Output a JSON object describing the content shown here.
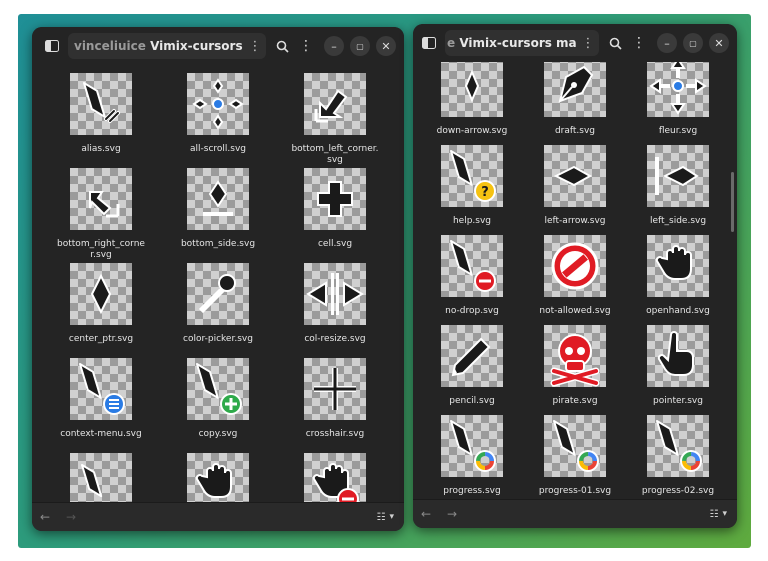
{
  "left_window": {
    "path_dim": "vinceliuice",
    "path_main": "Vimix-cursors master src-svg",
    "files": [
      {
        "label": "alias.svg",
        "icon": "alias-cursor-icon"
      },
      {
        "label": "all-scroll.svg",
        "icon": "all-scroll-cursor-icon"
      },
      {
        "label": "bottom_left_corner.\nsvg",
        "icon": "bottom-left-corner-cursor-icon"
      },
      {
        "label": "bottom_right_corne\nr.svg",
        "icon": "bottom-right-corner-cursor-icon"
      },
      {
        "label": "bottom_side.svg",
        "icon": "bottom-side-cursor-icon"
      },
      {
        "label": "cell.svg",
        "icon": "cell-cursor-icon"
      },
      {
        "label": "center_ptr.svg",
        "icon": "center-ptr-cursor-icon"
      },
      {
        "label": "color-picker.svg",
        "icon": "color-picker-cursor-icon"
      },
      {
        "label": "col-resize.svg",
        "icon": "col-resize-cursor-icon"
      },
      {
        "label": "context-menu.svg",
        "icon": "context-menu-cursor-icon"
      },
      {
        "label": "copy.svg",
        "icon": "copy-cursor-icon"
      },
      {
        "label": "crosshair.svg",
        "icon": "crosshair-cursor-icon"
      },
      {
        "label": "",
        "icon": "default-cursor-icon"
      },
      {
        "label": "",
        "icon": "dnd-cursor-icon"
      },
      {
        "label": "",
        "icon": "dnd-no-drop-cursor-icon"
      }
    ]
  },
  "right_window": {
    "path_dim": "e",
    "path_main": "Vimix-cursors master src-svg",
    "files": [
      {
        "label": "down-arrow.svg",
        "icon": "down-arrow-cursor-icon"
      },
      {
        "label": "draft.svg",
        "icon": "draft-cursor-icon"
      },
      {
        "label": "fleur.svg",
        "icon": "fleur-cursor-icon"
      },
      {
        "label": "help.svg",
        "icon": "help-cursor-icon"
      },
      {
        "label": "left-arrow.svg",
        "icon": "left-arrow-cursor-icon"
      },
      {
        "label": "left_side.svg",
        "icon": "left-side-cursor-icon"
      },
      {
        "label": "no-drop.svg",
        "icon": "no-drop-cursor-icon"
      },
      {
        "label": "not-allowed.svg",
        "icon": "not-allowed-cursor-icon"
      },
      {
        "label": "openhand.svg",
        "icon": "openhand-cursor-icon"
      },
      {
        "label": "pencil.svg",
        "icon": "pencil-cursor-icon"
      },
      {
        "label": "pirate.svg",
        "icon": "pirate-cursor-icon"
      },
      {
        "label": "pointer.svg",
        "icon": "pointer-cursor-icon"
      },
      {
        "label": "progress.svg",
        "icon": "progress-cursor-icon"
      },
      {
        "label": "progress-01.svg",
        "icon": "progress-01-cursor-icon"
      },
      {
        "label": "progress-02.svg",
        "icon": "progress-02-cursor-icon"
      }
    ]
  },
  "colors": {
    "desktop_gradient_start": "#1f8f96",
    "desktop_gradient_end": "#5faa3e",
    "window_bg": "#242424",
    "accent_blue": "#2a7be4",
    "accent_green": "#2eaa4a",
    "accent_red": "#e01b24",
    "accent_yellow": "#f5c211"
  }
}
